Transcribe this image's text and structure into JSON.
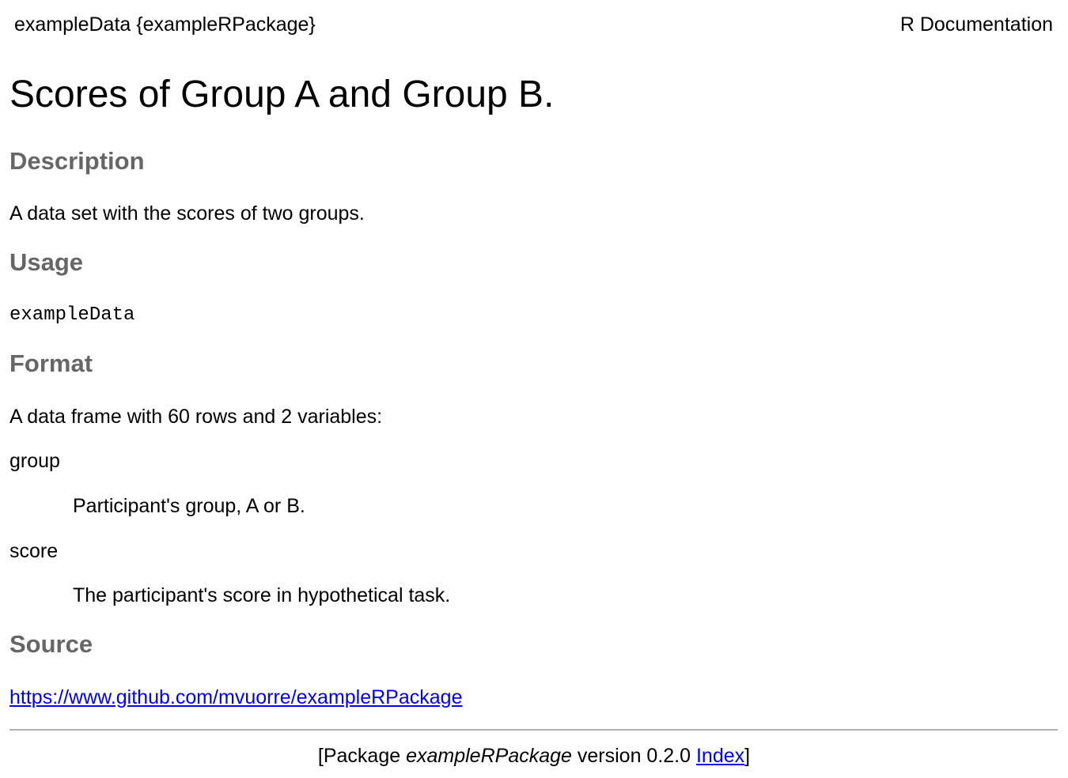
{
  "header": {
    "topic": "exampleData {exampleRPackage}",
    "doc_label": "R Documentation"
  },
  "title": "Scores of Group A and Group B.",
  "description": {
    "heading": "Description",
    "text": "A data set with the scores of two groups."
  },
  "usage": {
    "heading": "Usage",
    "code": "exampleData"
  },
  "format": {
    "heading": "Format",
    "text": "A data frame with 60 rows and 2 variables:",
    "items": [
      {
        "term": "group",
        "definition": "Participant's group, A or B."
      },
      {
        "term": "score",
        "definition": "The participant's score in hypothetical task."
      }
    ]
  },
  "source": {
    "heading": "Source",
    "link": "https://www.github.com/mvuorre/exampleRPackage"
  },
  "footer": {
    "open": "[Package ",
    "package_name": "exampleRPackage",
    "version_text": " version 0.2.0 ",
    "index_link": "Index",
    "close": "]"
  },
  "colors": {
    "heading": "#666666",
    "link": "#0000ee",
    "rule": "#b0b0b0"
  }
}
